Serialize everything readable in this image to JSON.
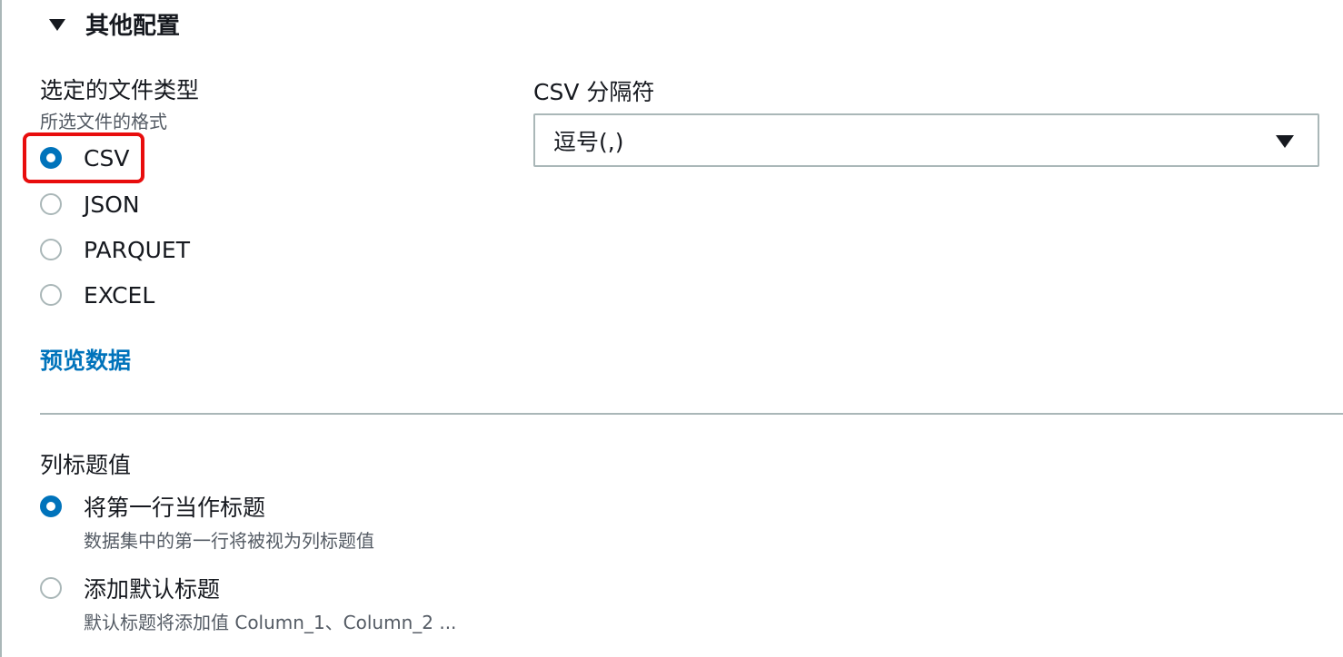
{
  "section": {
    "title": "其他配置"
  },
  "file_type": {
    "label": "选定的文件类型",
    "description": "所选文件的格式",
    "options": [
      {
        "label": "CSV",
        "selected": true
      },
      {
        "label": "JSON",
        "selected": false
      },
      {
        "label": "PARQUET",
        "selected": false
      },
      {
        "label": "EXCEL",
        "selected": false
      }
    ]
  },
  "preview_link": "预览数据",
  "csv_delimiter": {
    "label": "CSV 分隔符",
    "value": "逗号(,)"
  },
  "column_headers": {
    "label": "列标题值",
    "options": [
      {
        "label": "将第一行当作标题",
        "description": "数据集中的第一行将被视为列标题值",
        "selected": true
      },
      {
        "label": "添加默认标题",
        "description": "默认标题将添加值 Column_1、Column_2 ...",
        "selected": false
      }
    ]
  },
  "colors": {
    "accent": "#0073bb",
    "highlight": "#e80d0d",
    "border": "#aab7b8"
  }
}
